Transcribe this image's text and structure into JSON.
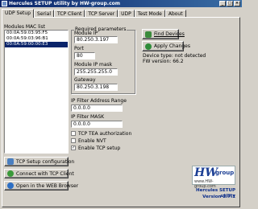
{
  "window": {
    "title": "Hercules SETUP utility by HW-group.com"
  },
  "tabs": [
    {
      "label": "UDP Setup",
      "active": true
    },
    {
      "label": "Serial",
      "active": false
    },
    {
      "label": "TCP Client",
      "active": false
    },
    {
      "label": "TCP Server",
      "active": false
    },
    {
      "label": "UDP",
      "active": false
    },
    {
      "label": "Test Mode",
      "active": false
    },
    {
      "label": "About",
      "active": false
    }
  ],
  "modules": {
    "label": "Modules MAC list",
    "items": [
      {
        "text": "00:0A:59:03:95:F5",
        "selected": false
      },
      {
        "text": "00:0A:59:03:96:B1",
        "selected": false
      },
      {
        "text": "00:0A:59:00:00:E3",
        "selected": true
      }
    ]
  },
  "required": {
    "title": "Required parameters",
    "module_ip_label": "Module IP",
    "module_ip": "80.250.3.197",
    "port_label": "Port",
    "port": "80",
    "mask_label": "Module IP mask",
    "mask": "255.255.255.0",
    "gateway_label": "Gateway",
    "gateway": "80.250.3.198"
  },
  "ip_filter": {
    "range_label": "IP Filter Address Range",
    "range": "0.0.0.0",
    "mask_label": "IP Filter MASK",
    "mask": "0.0.0.0"
  },
  "checkboxes": [
    {
      "label": "TCP TEA authorization",
      "checked": false
    },
    {
      "label": "Enable NVT",
      "checked": false
    },
    {
      "label": "Enable TCP setup",
      "checked": true
    }
  ],
  "actions": {
    "find_devices": "Find Devices",
    "apply_changes": "Apply Changes",
    "device_type": "Device type: not detected",
    "fw_version": "FW version:  66.2"
  },
  "left_buttons": {
    "tcp_setup": "TCP Setup configuration",
    "connect_tcp": "Connect with TCP Client",
    "open_web": "Open in the WEB Browser"
  },
  "logo": {
    "brand": "HW",
    "group": "group",
    "url": "www.HW-group.com",
    "product": "Hercules SETUP utility",
    "version": "Version 2.7.1"
  },
  "colors": {
    "window_bg": "#d4d0c8",
    "title_bar": "#0a246a",
    "selection": "#0a246a",
    "logo_blue": "#1c3f94"
  },
  "icons": {
    "find_devices": "magnifier-icon",
    "apply_changes": "refresh-icon",
    "tcp_setup": "setup-icon",
    "connect_tcp": "connect-icon",
    "open_web": "globe-icon"
  }
}
